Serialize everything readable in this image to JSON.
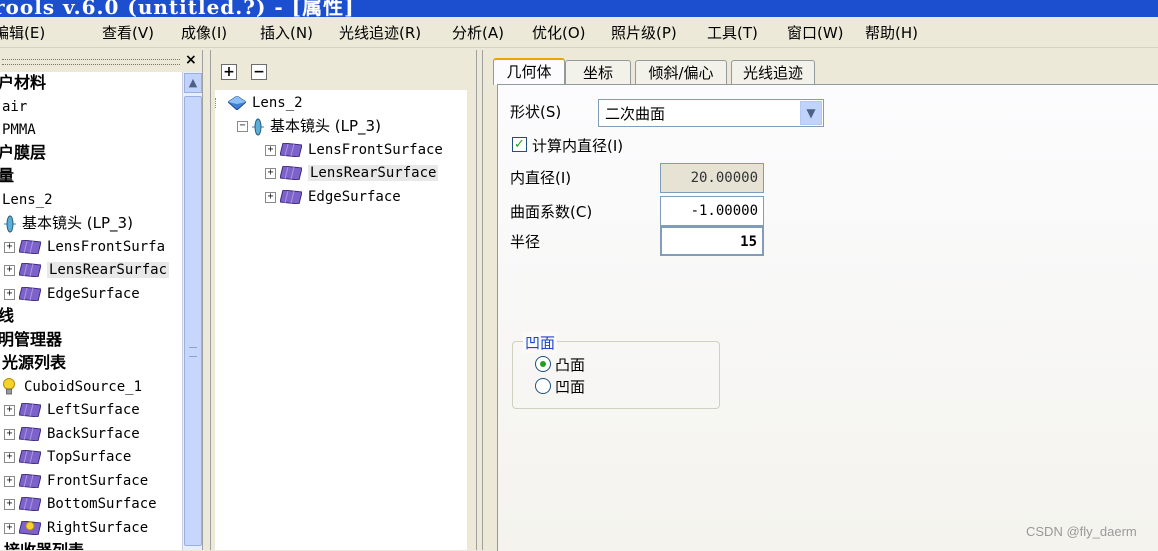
{
  "window": {
    "title": "rools v.6.0 (untitled.?) - [属性]"
  },
  "menu": [
    "编辑(E)",
    "查看(V)",
    "成像(I)",
    "插入(N)",
    "光线追迹(R)",
    "分析(A)",
    "优化(O)",
    "照片级(P)",
    "工具(T)",
    "窗口(W)",
    "帮助(H)"
  ],
  "left_tree": {
    "close_label": "×",
    "rows": [
      {
        "text": "户材料",
        "style": "cn-bold"
      },
      {
        "text": "air",
        "style": "mono"
      },
      {
        "text": "PMMA",
        "style": "mono"
      },
      {
        "text": "户膜层",
        "style": "cn-bold"
      },
      {
        "text": "量",
        "style": "cn-bold"
      },
      {
        "text": "Lens_2",
        "style": "mono"
      },
      {
        "text": "基本镜头 (LP_3)",
        "style": "cn",
        "icon": "lens-icon"
      },
      {
        "text": "LensFrontSurfa",
        "style": "mono",
        "icon": "surface-icon",
        "expander": "+"
      },
      {
        "text": "LensRearSurfac",
        "style": "mono",
        "icon": "surface-icon",
        "expander": "+",
        "selected": true
      },
      {
        "text": "EdgeSurface",
        "style": "mono",
        "icon": "surface-icon",
        "expander": "+"
      },
      {
        "text": "线",
        "style": "cn-bold"
      },
      {
        "text": "明管理器",
        "style": "cn-bold"
      },
      {
        "text": "光源列表",
        "style": "cn-bold"
      },
      {
        "text": "CuboidSource_1",
        "style": "mono",
        "icon": "bulb-icon"
      },
      {
        "text": "LeftSurface",
        "style": "mono",
        "icon": "surface-icon",
        "expander": "+"
      },
      {
        "text": "BackSurface",
        "style": "mono",
        "icon": "surface-icon",
        "expander": "+"
      },
      {
        "text": "TopSurface",
        "style": "mono",
        "icon": "surface-icon",
        "expander": "+"
      },
      {
        "text": "FrontSurface",
        "style": "mono",
        "icon": "surface-icon",
        "expander": "+"
      },
      {
        "text": "BottomSurface",
        "style": "mono",
        "icon": "surface-icon",
        "expander": "+"
      },
      {
        "text": "RightSurface",
        "style": "mono",
        "icon": "bulb-surface-icon",
        "expander": "+"
      },
      {
        "text": "接收器列表",
        "style": "cn-bold"
      }
    ]
  },
  "mid_tree": {
    "expand_all_label": "+",
    "collapse_all_label": "−",
    "rows": [
      {
        "text": "Lens_2",
        "style": "mono"
      },
      {
        "text": "基本镜头 (LP_3)",
        "style": "cn"
      },
      {
        "text": "LensFrontSurface",
        "style": "mono",
        "expander": "+"
      },
      {
        "text": "LensRearSurface",
        "style": "mono",
        "expander": "+",
        "selected": true
      },
      {
        "text": "EdgeSurface",
        "style": "mono",
        "expander": "+"
      }
    ]
  },
  "properties": {
    "tabs": [
      "几何体",
      "坐标",
      "倾斜/偏心",
      "光线追迹"
    ],
    "active_tab": "几何体",
    "shape_label": "形状(S)",
    "shape_value": "二次曲面",
    "calc_inner_diameter_label": "计算内直径(I)",
    "calc_inner_diameter_checked": true,
    "inner_diameter_label": "内直径(I)",
    "inner_diameter_value": "20.00000",
    "conic_label": "曲面系数(C)",
    "conic_value": "-1.00000",
    "radius_label": "半径",
    "radius_value": "15",
    "group_title": "凹面",
    "option_convex": "凸面",
    "option_concave": "凹面",
    "selected_option": "凸面"
  },
  "watermark": "CSDN @fly_daerm"
}
